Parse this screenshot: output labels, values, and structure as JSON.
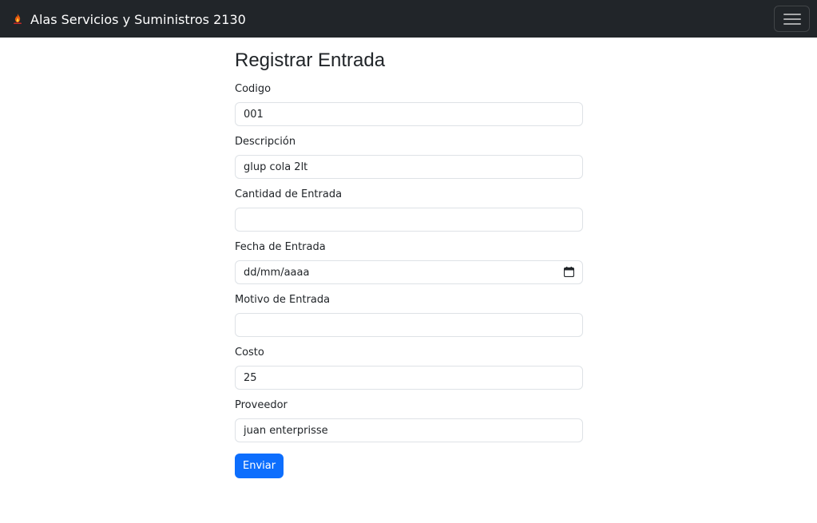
{
  "navbar": {
    "brand": "Alas Servicios y Suministros 2130",
    "logo_icon": "flame-icon",
    "toggler_icon": "hamburger-menu-icon"
  },
  "form": {
    "title": "Registrar Entrada",
    "fields": {
      "codigo": {
        "label": "Codigo",
        "value": "001"
      },
      "descripcion": {
        "label": "Descripción",
        "value": "glup cola 2lt"
      },
      "cantidad": {
        "label": "Cantidad de Entrada",
        "value": ""
      },
      "fecha": {
        "label": "Fecha de Entrada",
        "value": "dd/mm/aaaa"
      },
      "motivo": {
        "label": "Motivo de Entrada",
        "value": ""
      },
      "costo": {
        "label": "Costo",
        "value": "25"
      },
      "proveedor": {
        "label": "Proveedor",
        "value": "juan enterprisse"
      }
    },
    "submit_label": "Enviar"
  },
  "colors": {
    "navbar_bg": "#212529",
    "primary": "#0d6efd",
    "input_border": "#dee2e6"
  }
}
